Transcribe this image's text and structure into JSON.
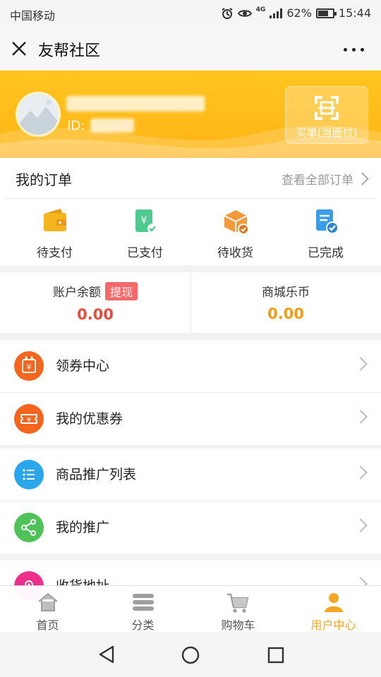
{
  "status_bar": {
    "carrier": "中国移动",
    "network": "4G",
    "battery": "62%",
    "battery_level": 0.62,
    "time": "15:44"
  },
  "titlebar": {
    "title": "友帮社区"
  },
  "profile": {
    "id_label": "ID:",
    "scan_button_label": "买单(当面付)"
  },
  "orders": {
    "title": "我的订单",
    "view_all": "查看全部订单",
    "items": [
      {
        "label": "待支付",
        "icon": "wallet-icon"
      },
      {
        "label": "已支付",
        "icon": "receipt-check-icon"
      },
      {
        "label": "待收货",
        "icon": "package-icon"
      },
      {
        "label": "已完成",
        "icon": "document-check-icon"
      }
    ]
  },
  "balance": {
    "account_label": "账户余额",
    "withdraw_label": "提现",
    "account_value": "0.00",
    "coins_label": "商城乐币",
    "coins_value": "0.00"
  },
  "menu": [
    {
      "label": "领券中心",
      "icon": "coupon-center-icon",
      "color": "#f5651e"
    },
    {
      "label": "我的优惠券",
      "icon": "coupon-icon",
      "color": "#f5651e"
    },
    {
      "label": "商品推广列表",
      "icon": "list-icon",
      "color": "#2aa6ea"
    },
    {
      "label": "我的推广",
      "icon": "share-icon",
      "color": "#4fc25a"
    },
    {
      "label": "收货地址",
      "icon": "location-icon",
      "color": "#ee2f8c"
    }
  ],
  "tabbar": [
    {
      "label": "首页",
      "icon": "home-icon"
    },
    {
      "label": "分类",
      "icon": "category-icon"
    },
    {
      "label": "购物车",
      "icon": "cart-icon"
    },
    {
      "label": "用户中心",
      "icon": "user-icon",
      "active": true
    }
  ],
  "colors": {
    "brand": "#ffb415",
    "accent_red": "#e74c3c",
    "accent_orange": "#f39c12",
    "active_tab": "#f5a623"
  }
}
